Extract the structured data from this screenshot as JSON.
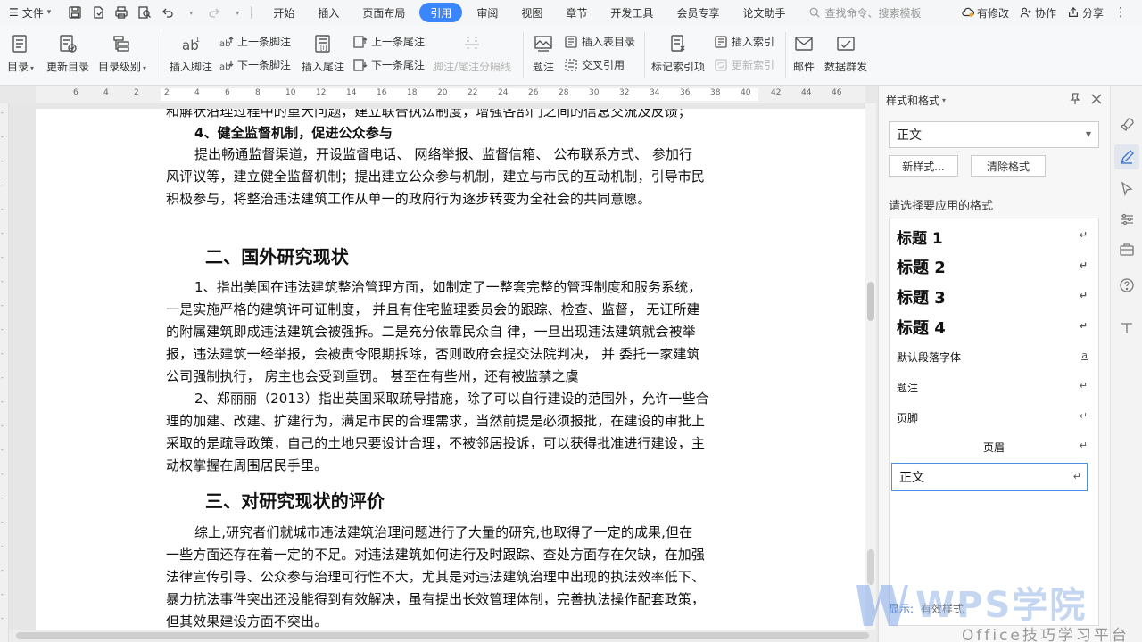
{
  "menubar": {
    "file_label": "文件",
    "tabs": [
      "开始",
      "插入",
      "页面布局",
      "引用",
      "审阅",
      "视图",
      "章节",
      "开发工具",
      "会员专享",
      "论文助手"
    ],
    "active_tab": "引用",
    "search_placeholder": "查找命令、搜索模板",
    "has_changes_label": "有修改",
    "collaborate_label": "协作",
    "share_label": "分享",
    "accent_color": "#3a86ff"
  },
  "ribbon": {
    "toc": "目录",
    "update_toc": "更新目录",
    "toc_level": "目录级别",
    "insert_footnote": "插入脚注",
    "prev_footnote": "上一条脚注",
    "next_footnote": "下一条脚注",
    "insert_endnote": "插入尾注",
    "prev_endnote": "上一条尾注",
    "next_endnote": "下一条尾注",
    "footnote_separator": "脚注/尾注分隔线",
    "caption": "题注",
    "insert_table_of_figures": "插入表目录",
    "cross_reference": "交叉引用",
    "mark_index_entry": "标记索引项",
    "insert_index": "插入索引",
    "update_index": "更新索引",
    "mail": "邮件",
    "data_mailing": "数据群发"
  },
  "ruler": {
    "numbers": [
      "6",
      "4",
      "2",
      "2",
      "4",
      "6",
      "8",
      "10",
      "12",
      "14",
      "16",
      "18",
      "20",
      "22",
      "24",
      "26",
      "28",
      "30",
      "32",
      "34",
      "36",
      "38",
      "40",
      "42",
      "44",
      "46"
    ]
  },
  "document": {
    "lines": [
      "和解状沿理过程中的重大问题，建立联合执法制度，增强各部门之间的信息交流及反馈；",
      "4、健全监督机制，促进公众参与",
      "提出畅通监督渠道，开设监督电话、 网络举报、监督信箱、 公布联系方式、 参加行",
      "风评议等，建立健全监督机制；提出建立公众参与机制，建立与市民的互动机制，引导市民",
      "积极参与，将整治违法建筑工作从单一的政府行为逐步转变为全社会的共同意愿。",
      "二、国外研究现状",
      "1、指出美国在违法建筑整治管理方面，如制定了一整套完整的管理制度和服务系统，",
      "一是实施严格的建筑许可证制度， 并且有住宅监理委员会的跟踪、检查、监督， 无证所建",
      "的附属建筑即成违法建筑会被强拆。二是充分依靠民众自 律，一旦出现违法建筑就会被举",
      "报，违法建筑一经举报，会被责令限期拆除，否则政府会提交法院判决， 并 委托一家建筑",
      "公司强制执行， 房主也会受到重罚。 甚至在有些州，还有被监禁之虞",
      "2、郑丽丽（2013）指出英国采取疏导措施，除了可以自行建设的范围外，允许一些合",
      "理的加建、改建、扩建行为，满足市民的合理需求，当然前提是必须报批，在建设的审批上",
      "采取的是疏导政策，自己的土地只要设计合理，不被邻居投诉，可以获得批准进行建设，主",
      "动权掌握在周围居民手里。",
      "三、对研究现状的评价",
      "综上,研究者们就城市违法建筑治理问题进行了大量的研究,也取得了一定的成果,但在",
      "一些方面还存在着一定的不足。对违法建筑如何进行及时跟踪、查处方面存在欠缺，在加强",
      "法律宣传引导、公众参与治理可行性不大，尤其是对违法建筑治理中出现的执法效率低下、",
      "暴力抗法事件突出还没能得到有效解决，虽有提出长效管理体制，完善执法操作配套政策，",
      "但其效果建设方面不突出。"
    ]
  },
  "panel": {
    "title": "样式和格式",
    "current_style": "正文",
    "new_style": "新样式...",
    "clear_format": "清除格式",
    "hint": "请选择要应用的格式",
    "return_mark": "↵",
    "char_mark": "a",
    "styles": [
      "标题 1",
      "标题 2",
      "标题 3",
      "标题 4",
      "默认段落字体",
      "题注",
      "页脚",
      "页眉",
      "正文"
    ],
    "show_label": "显示:",
    "show_value": "有效样式"
  },
  "watermark": {
    "brand": "WPS学院",
    "tagline": "Office技巧学习平台"
  }
}
